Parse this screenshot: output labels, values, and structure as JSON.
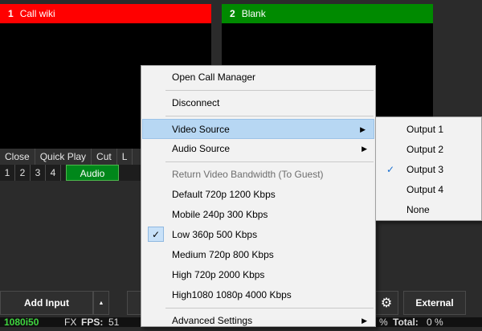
{
  "inputs": [
    {
      "number": "1",
      "title": "Call wiki",
      "color": "#ff0000"
    },
    {
      "number": "2",
      "title": "Blank",
      "color": "#008a00"
    }
  ],
  "controls": {
    "buttons": [
      "Close",
      "Quick Play",
      "Cut",
      "L"
    ],
    "numbers": [
      "1",
      "2",
      "3",
      "4"
    ],
    "audio_label": "Audio"
  },
  "bottom": {
    "add_input_label": "Add Input",
    "external_label": "External",
    "settings_icon": "gear-icon"
  },
  "status": {
    "format": "1080i50",
    "fx_fragment": "FX",
    "fps_label": "FPS:",
    "fps_value": "51",
    "right_fragment": "%",
    "total_label": "Total:",
    "total_value": "0 %"
  },
  "context_menu": {
    "items": [
      {
        "label": "Open Call Manager"
      },
      {
        "label": "Disconnect"
      },
      {
        "label": "Video Source",
        "submenu": true,
        "highlighted": true
      },
      {
        "label": "Audio Source",
        "submenu": true
      },
      {
        "label": "Return Video Bandwidth (To Guest)",
        "disabled": true
      },
      {
        "label": "Default 720p 1200 Kbps"
      },
      {
        "label": "Mobile 240p 300 Kbps"
      },
      {
        "label": "Low 360p 500 Kbps",
        "checked": true
      },
      {
        "label": "Medium 720p 800 Kbps"
      },
      {
        "label": "High 720p 2000 Kbps"
      },
      {
        "label": "High1080 1080p 4000 Kbps"
      },
      {
        "label": "Advanced Settings",
        "submenu": true
      }
    ]
  },
  "video_source_submenu": {
    "items": [
      {
        "label": "Output 1"
      },
      {
        "label": "Output 2"
      },
      {
        "label": "Output 3",
        "checked": true
      },
      {
        "label": "Output 4"
      },
      {
        "label": "None"
      }
    ]
  },
  "colors": {
    "accent_highlight": "#b7d7f3",
    "audio_green": "#00871a"
  }
}
